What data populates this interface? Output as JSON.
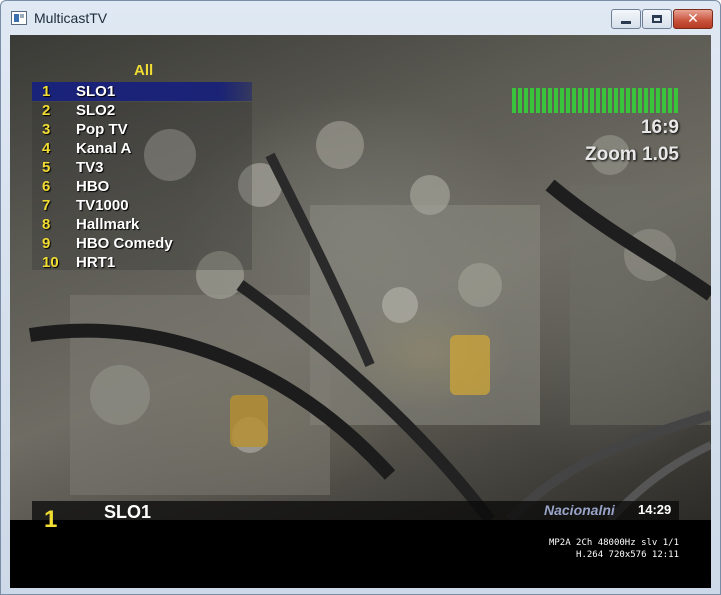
{
  "window": {
    "title": "MulticastTV",
    "close_glyph": "✕"
  },
  "list": {
    "header": "All",
    "items": [
      {
        "num": "1",
        "name": "SLO1"
      },
      {
        "num": "2",
        "name": "SLO2"
      },
      {
        "num": "3",
        "name": "Pop TV"
      },
      {
        "num": "4",
        "name": "Kanal A"
      },
      {
        "num": "5",
        "name": "TV3"
      },
      {
        "num": "6",
        "name": "HBO"
      },
      {
        "num": "7",
        "name": "TV1000"
      },
      {
        "num": "8",
        "name": "Hallmark"
      },
      {
        "num": "9",
        "name": "HBO Comedy"
      },
      {
        "num": "10",
        "name": "HRT1"
      }
    ],
    "selected_index": 0
  },
  "osd": {
    "signal_level": 1.0,
    "aspect": "16:9",
    "zoom": "Zoom 1.05"
  },
  "infobar": {
    "channel_num": "1",
    "channel_name": "SLO1",
    "network": "Nacionalni",
    "time": "14:29",
    "audio_info": "MP2A 2Ch 48000Hz slv 1/1",
    "video_info": "H.264 720x576 12:11"
  },
  "colors": {
    "accent_yellow": "#f0dc32",
    "selection_blue": "#1a237a",
    "signal_green": "#39c43c"
  }
}
